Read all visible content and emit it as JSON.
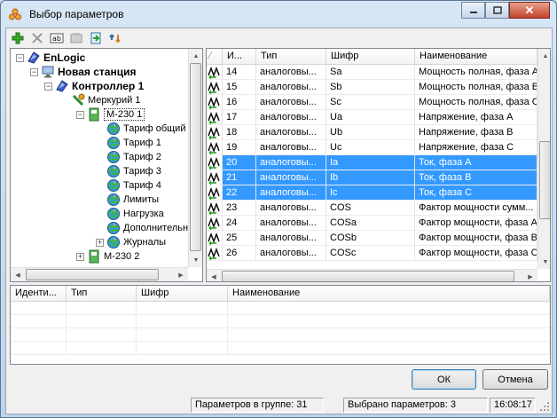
{
  "window": {
    "title": "Выбор параметров"
  },
  "toolbar": {
    "icons": [
      "add-icon",
      "delete-icon",
      "rename-icon",
      "properties-icon",
      "import-icon",
      "undo-icon"
    ]
  },
  "tree": [
    {
      "label": "EnLogic",
      "bold": true,
      "level": 0,
      "icon": "logo"
    },
    {
      "label": "Новая станция",
      "bold": true,
      "level": 1,
      "icon": "computer"
    },
    {
      "label": "Контроллер 1",
      "bold": true,
      "level": 2,
      "icon": "logo"
    },
    {
      "label": "Меркурий 1",
      "bold": false,
      "level": 3,
      "icon": "node"
    },
    {
      "label": "М-230 1",
      "bold": false,
      "level": 4,
      "icon": "meter",
      "selected": true
    },
    {
      "label": "Тариф общий",
      "bold": false,
      "level": 5,
      "icon": "globe"
    },
    {
      "label": "Тариф 1",
      "bold": false,
      "level": 5,
      "icon": "globe"
    },
    {
      "label": "Тариф 2",
      "bold": false,
      "level": 5,
      "icon": "globe"
    },
    {
      "label": "Тариф 3",
      "bold": false,
      "level": 5,
      "icon": "globe"
    },
    {
      "label": "Тариф 4",
      "bold": false,
      "level": 5,
      "icon": "globe"
    },
    {
      "label": "Лимиты",
      "bold": false,
      "level": 5,
      "icon": "globe"
    },
    {
      "label": "Нагрузка",
      "bold": false,
      "level": 5,
      "icon": "globe"
    },
    {
      "label": "Дополнительно",
      "bold": false,
      "level": 5,
      "icon": "globe"
    },
    {
      "label": "Журналы",
      "bold": false,
      "level": 5,
      "icon": "globe",
      "expander": true
    },
    {
      "label": "М-230 2",
      "bold": false,
      "level": 4,
      "icon": "meter",
      "expander": true
    }
  ],
  "grid": {
    "headers": [
      "И...",
      "Тип",
      "Шифр",
      "Наименование"
    ],
    "rows": [
      {
        "id": "14",
        "type": "аналоговы...",
        "code": "Sa",
        "name": "Мощность полная, фаза А",
        "selected": false
      },
      {
        "id": "15",
        "type": "аналоговы...",
        "code": "Sb",
        "name": "Мощность полная, фаза В",
        "selected": false
      },
      {
        "id": "16",
        "type": "аналоговы...",
        "code": "Sc",
        "name": "Мощность полная, фаза С",
        "selected": false
      },
      {
        "id": "17",
        "type": "аналоговы...",
        "code": "Ua",
        "name": "Напряжение, фаза А",
        "selected": false
      },
      {
        "id": "18",
        "type": "аналоговы...",
        "code": "Ub",
        "name": "Напряжение, фаза В",
        "selected": false
      },
      {
        "id": "19",
        "type": "аналоговы...",
        "code": "Uc",
        "name": "Напряжение, фаза С",
        "selected": false
      },
      {
        "id": "20",
        "type": "аналоговы...",
        "code": "Ia",
        "name": "Ток, фаза А",
        "selected": true
      },
      {
        "id": "21",
        "type": "аналоговы...",
        "code": "Ib",
        "name": "Ток, фаза В",
        "selected": true
      },
      {
        "id": "22",
        "type": "аналоговы...",
        "code": "Ic",
        "name": "Ток, фаза С",
        "selected": true
      },
      {
        "id": "23",
        "type": "аналоговы...",
        "code": "COS",
        "name": "Фактор мощности сумм...",
        "selected": false
      },
      {
        "id": "24",
        "type": "аналоговы...",
        "code": "COSa",
        "name": "Фактор мощности, фаза А",
        "selected": false
      },
      {
        "id": "25",
        "type": "аналоговы...",
        "code": "COSb",
        "name": "Фактор мощности, фаза В",
        "selected": false
      },
      {
        "id": "26",
        "type": "аналоговы...",
        "code": "COSc",
        "name": "Фактор мощности, фаза С",
        "selected": false
      }
    ]
  },
  "selected_list": {
    "headers": [
      "Иденти...",
      "Тип",
      "Шифр",
      "Наименование"
    ]
  },
  "buttons": {
    "ok": "ОК",
    "cancel": "Отмена"
  },
  "status": {
    "group_count": "Параметров в группе: 31",
    "selected_count": "Выбрано параметров: 3",
    "time": "16:08:17"
  }
}
